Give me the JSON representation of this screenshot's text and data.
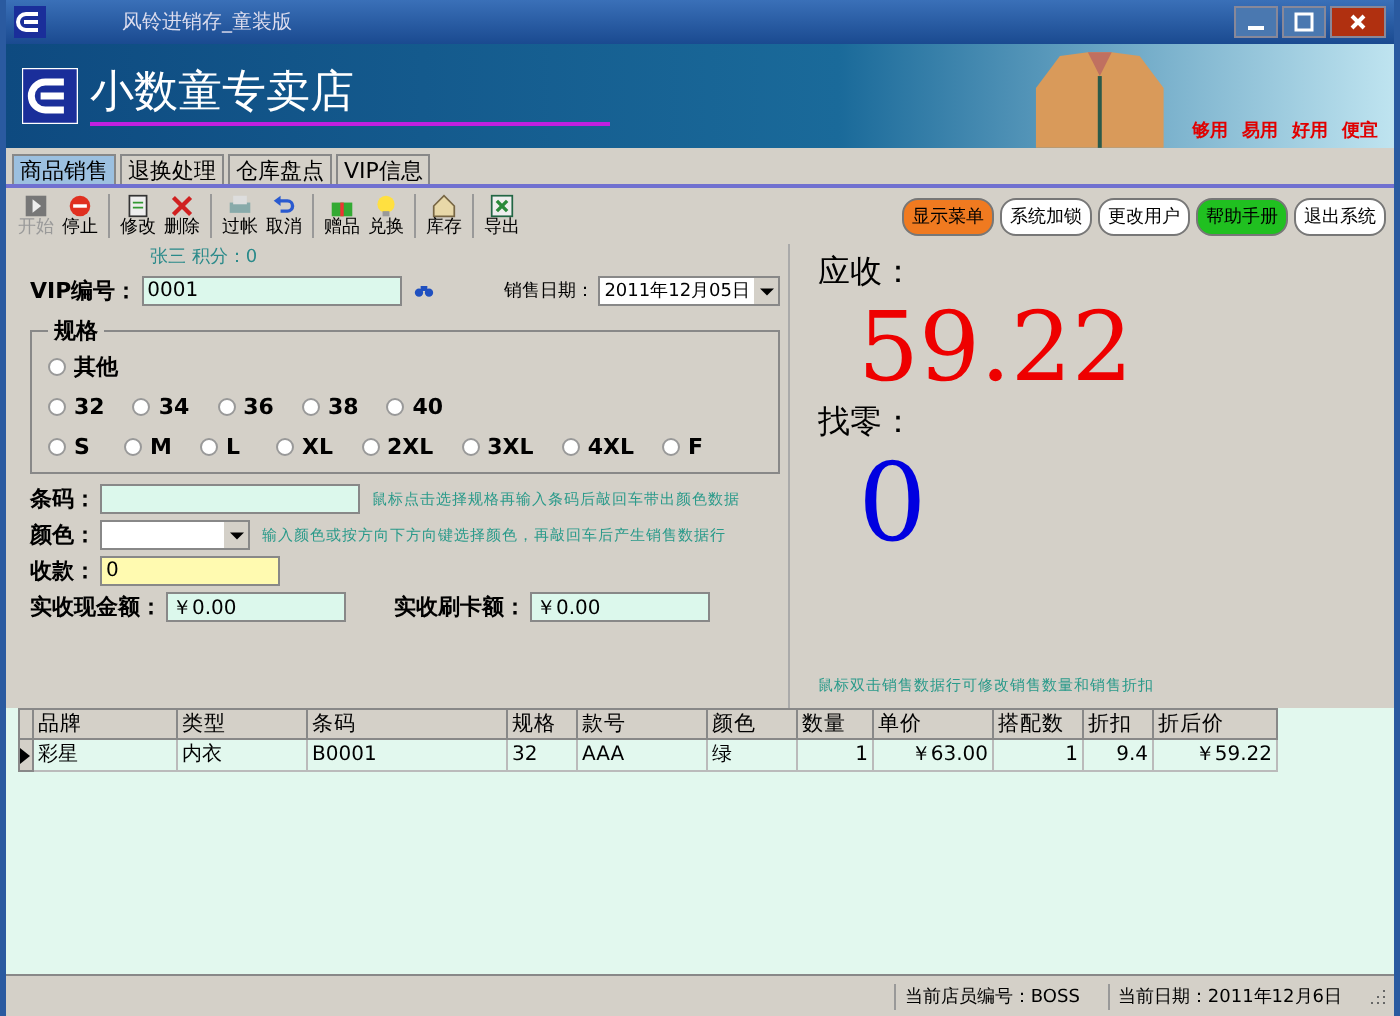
{
  "window": {
    "title": "风铃进销存_童装版"
  },
  "banner": {
    "shop_name": "小数童专卖店",
    "slogans": [
      "够用",
      "易用",
      "好用",
      "便宜"
    ]
  },
  "tabs": [
    {
      "label": "商品销售",
      "selected": true
    },
    {
      "label": "退换处理",
      "selected": false
    },
    {
      "label": "仓库盘点",
      "selected": false
    },
    {
      "label": "VIP信息",
      "selected": false
    }
  ],
  "toolbar": [
    {
      "label": "开始",
      "disabled": true
    },
    {
      "label": "停止",
      "disabled": false
    },
    {
      "label": "修改",
      "disabled": false
    },
    {
      "label": "删除",
      "disabled": false
    },
    {
      "label": "过帐",
      "disabled": false
    },
    {
      "label": "取消",
      "disabled": false
    },
    {
      "label": "赠品",
      "disabled": false
    },
    {
      "label": "兑换",
      "disabled": false
    },
    {
      "label": "库存",
      "disabled": false
    },
    {
      "label": "导出",
      "disabled": false
    }
  ],
  "header_buttons": [
    {
      "label": "显示菜单",
      "color": "#f07a20"
    },
    {
      "label": "系统加锁",
      "color": "#ffffff"
    },
    {
      "label": "更改用户",
      "color": "#ffffff"
    },
    {
      "label": "帮助手册",
      "color": "#20c020"
    },
    {
      "label": "退出系统",
      "color": "#ffffff"
    }
  ],
  "vip": {
    "member_info": "张三  积分：0",
    "label": "VIP编号：",
    "value": "0001"
  },
  "sale_date": {
    "label": "销售日期：",
    "value": "2011年12月05日"
  },
  "size_group": {
    "title": "规格",
    "rows": [
      [
        {
          "label": "其他",
          "selected": false
        }
      ],
      [
        {
          "label": "32",
          "selected": false
        },
        {
          "label": "34",
          "selected": false
        },
        {
          "label": "36",
          "selected": false
        },
        {
          "label": "38",
          "selected": false
        },
        {
          "label": "40",
          "selected": false
        }
      ],
      [
        {
          "label": "S",
          "selected": false
        },
        {
          "label": "M",
          "selected": false
        },
        {
          "label": "L",
          "selected": false
        },
        {
          "label": "XL",
          "selected": false
        },
        {
          "label": "2XL",
          "selected": false
        },
        {
          "label": "3XL",
          "selected": false
        },
        {
          "label": "4XL",
          "selected": false
        },
        {
          "label": "F",
          "selected": false
        }
      ]
    ]
  },
  "barcode": {
    "label": "条码：",
    "hint": "鼠标点击选择规格再输入条码后敲回车带出颜色数据"
  },
  "color_field": {
    "label": "颜色：",
    "hint": "输入颜色或按方向下方向键选择颜色，再敲回车后产生销售数据行"
  },
  "payment": {
    "label": "收款：",
    "value": "0"
  },
  "cash": {
    "label": "实收现金额：",
    "value": "￥0.00"
  },
  "card": {
    "label": "实收刷卡额：",
    "value": "￥0.00"
  },
  "receivable": {
    "label": "应收：",
    "value": "59.22"
  },
  "change": {
    "label": "找零：",
    "value": "0"
  },
  "grid_hint": "鼠标双击销售数据行可修改销售数量和销售折扣",
  "table": {
    "columns": [
      "品牌",
      "类型",
      "条码",
      "规格",
      "款号",
      "颜色",
      "数量",
      "单价",
      "搭配数",
      "折扣",
      "折后价"
    ],
    "rows": [
      {
        "selected": true,
        "cells": [
          "彩星",
          "内衣",
          "B0001",
          "32",
          "AAA",
          "绿",
          "1",
          "￥63.00",
          "1",
          "9.4",
          "￥59.22"
        ]
      }
    ]
  },
  "status_bar": [
    "当前店员编号：BOSS",
    "当前日期：2011年12月6日"
  ]
}
